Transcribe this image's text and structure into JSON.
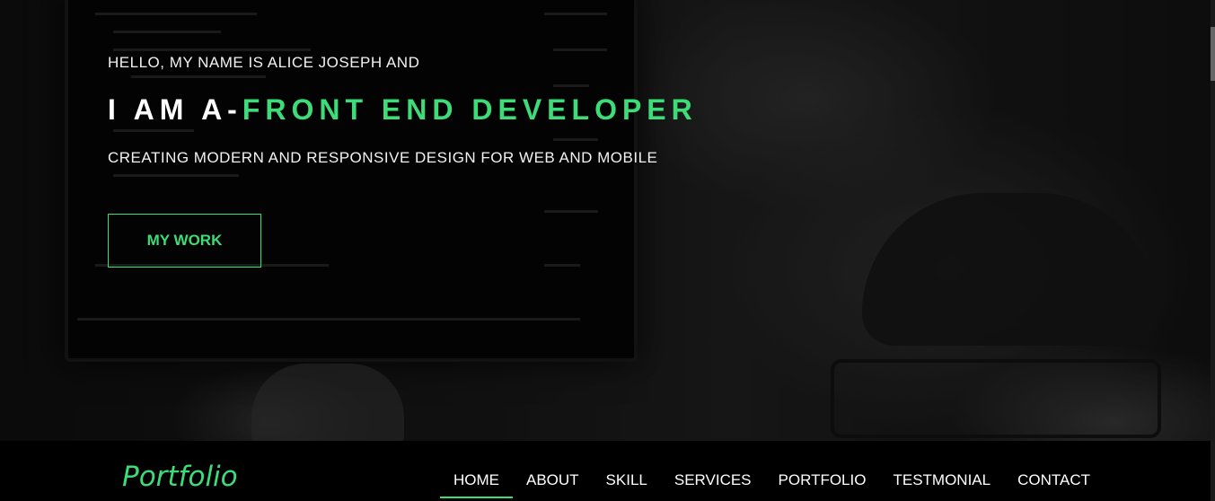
{
  "hero": {
    "intro": "HELLO, MY NAME IS ALICE JOSEPH AND",
    "headline_prefix": "I AM A-",
    "headline_role": "FRONT END DEVELOPER",
    "tagline": "CREATING MODERN AND RESPONSIVE DESIGN FOR WEB AND MOBILE",
    "cta_label": "MY WORK"
  },
  "navbar": {
    "brand": "Portfolio",
    "items": [
      {
        "label": "HOME",
        "active": true
      },
      {
        "label": "ABOUT"
      },
      {
        "label": "SKILL"
      },
      {
        "label": "SERVICES"
      },
      {
        "label": "PORTFOLIO"
      },
      {
        "label": "TESTMONIAL"
      },
      {
        "label": "CONTACT"
      }
    ]
  },
  "colors": {
    "accent": "#3ddc78",
    "text": "#ffffff",
    "navbar_bg": "#000000"
  }
}
